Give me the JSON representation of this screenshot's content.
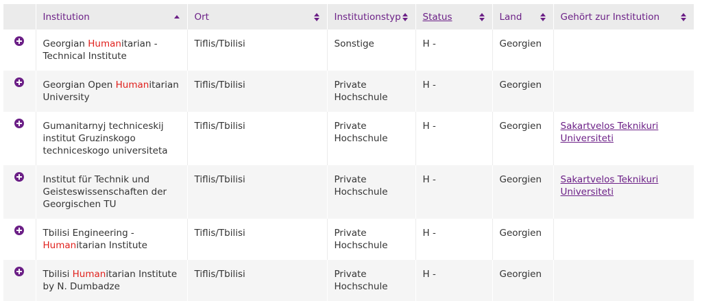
{
  "table": {
    "headers": [
      {
        "label": "Institution",
        "sort": "asc"
      },
      {
        "label": "Ort",
        "sort": "both"
      },
      {
        "label": "Institutionstyp",
        "sort": "both"
      },
      {
        "label": "Status",
        "sort": "both"
      },
      {
        "label": "Land",
        "sort": "both"
      },
      {
        "label": "Gehört zur Institution",
        "sort": "both"
      }
    ],
    "rows": [
      {
        "name_parts": [
          "Georgian ",
          "Human",
          "itarian -",
          "Technical Institute"
        ],
        "ort": "Tiflis/Tbilisi",
        "typ": "Sonstige",
        "status": "H -",
        "land": "Georgien",
        "parent": ""
      },
      {
        "name_parts": [
          "Georgian Open ",
          "Human",
          "itarian",
          "University"
        ],
        "ort": "Tiflis/Tbilisi",
        "typ": "Private Hochschule",
        "status": "H -",
        "land": "Georgien",
        "parent": ""
      },
      {
        "name": "Gumanitarnyj techniceskij institut Gruzinskogo techniceskogo universiteta",
        "ort": "Tiflis/Tbilisi",
        "typ": "Private Hochschule",
        "status": "H -",
        "land": "Georgien",
        "parent": "Sakartvelos Teknikuri Universiteti"
      },
      {
        "name": "Institut für Technik und Geisteswissenschaften der Georgischen TU",
        "ort": "Tiflis/Tbilisi",
        "typ": "Private Hochschule",
        "status": "H -",
        "land": "Georgien",
        "parent": "Sakartvelos Teknikuri Universiteti"
      },
      {
        "name_parts": [
          "Tbilisi Engineering -",
          "Human",
          "itarian Institute"
        ],
        "ort": "Tiflis/Tbilisi",
        "typ": "Private Hochschule",
        "status": "H -",
        "land": "Georgien",
        "parent": ""
      },
      {
        "name_parts": [
          "Tbilisi ",
          "Human",
          "itarian Institute",
          "by N. Dumbadze"
        ],
        "ort": "Tiflis/Tbilisi",
        "typ": "Private Hochschule",
        "status": "H -",
        "land": "Georgien",
        "parent": ""
      }
    ]
  },
  "colors": {
    "accent": "#6b1f86",
    "highlight": "#e0201c",
    "header_bg": "#ebebeb",
    "stripe_bg": "#f5f5f5"
  },
  "icons": {
    "expand": "plus-circle-icon",
    "sort_asc": "sort-asc-icon",
    "sort_both": "sort-both-icon"
  }
}
